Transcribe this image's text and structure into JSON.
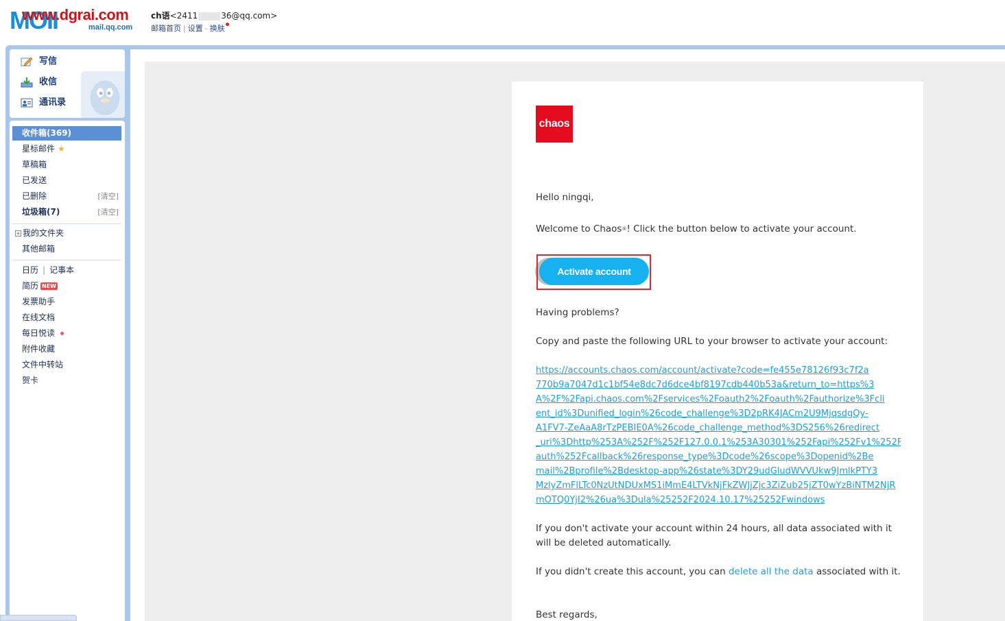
{
  "header": {
    "logo_text": "MOII",
    "watermark": "www.dgrai.com",
    "logo_sub": "mail.qq.com",
    "user_name": "ch语",
    "email_prefix": "<2411",
    "email_suffix": "36@qq.com>",
    "links": [
      "邮箱首页",
      "设置",
      "换肤"
    ]
  },
  "sidebar": {
    "quick_actions": [
      {
        "label": "写信",
        "icon": "pencil-icon"
      },
      {
        "label": "收信",
        "icon": "download-icon"
      },
      {
        "label": "通讯录",
        "icon": "contacts-icon"
      }
    ],
    "folders": [
      {
        "label": "收件箱(369)",
        "active": true
      },
      {
        "label": "星标邮件"
      },
      {
        "label": "草稿箱"
      },
      {
        "label": "已发送"
      },
      {
        "label": "已删除",
        "clear": "[清空]"
      },
      {
        "label": "垃圾箱(7)",
        "clear": "[清空]",
        "bold": true
      }
    ],
    "group2": [
      "我的文件夹",
      "其他邮箱"
    ],
    "calendar": "日历",
    "calendar_sep": "|",
    "notebook": "记事本",
    "apps": [
      "简历",
      "发票助手",
      "在线文档",
      "每日悦读",
      "附件收藏",
      "文件中转站",
      "贺卡"
    ],
    "new_badge": "NEW"
  },
  "email": {
    "logo": "chaos",
    "greeting": "Hello ningqi,",
    "welcome_pre": "Welcome to Chaos",
    "welcome_sup": "®",
    "welcome_post": "! Click the button below to activate your account.",
    "button": "Activate account",
    "problems": "Having problems?",
    "copy_paste": "Copy and paste the following URL to your browser to activate your account:",
    "url_lines": [
      "https://accounts.chaos.com/account/activate?code=fe455e78126f93c7f2a",
      "770b9a7047d1c1bf54e8dc7d6dce4bf8197cdb440b53a&return_to=https%3",
      "A%2F%2Fapi.chaos.com%2Fservices%2Foauth2%2Foauth%2Fauthorize%3Fcli",
      "ent_id%3Dunified_login%26code_challenge%3D2pRK4JACm2U9MjqsdgQy-",
      "A1FV7-ZeAaA8rTzPEBIE0A%26code_challenge_method%3DS256%26redirect",
      "_uri%3Dhttp%253A%252F%252F127.0.0.1%253A30301%252Fapi%252Fv1%252Fo",
      "auth%252Fcallback%26response_type%3Dcode%26scope%3Dopenid%2Be",
      "mail%2Bprofile%2Bdesktop-app%26state%3DY29udGludWVVUkw9JmlkPTY3",
      "MzlyZmFlLTc0NzUtNDUxMS1iMmE4LTVkNjFkZWJjZjc3ZiZub25jZT0wYzBiNTM2NjR",
      "mOTQ0YjI2%26ua%3Dula%25252F2024.10.17%25252Fwindows"
    ],
    "notice_24h": "If you don't activate your account within 24 hours, all data associated with it will be deleted automatically.",
    "didnt_create_pre": "If you didn't create this account, you can ",
    "didnt_create_link": "delete all the data",
    "didnt_create_post": " associated with it.",
    "regards": "Best regards,"
  },
  "colors": {
    "frame_blue": "#a9c6ec",
    "active_folder": "#5b8fd6",
    "chaos_red": "#e50b1f",
    "button_blue": "#17b1f0",
    "link_blue": "#1f9fd9",
    "highlight_red": "#e0262b"
  }
}
